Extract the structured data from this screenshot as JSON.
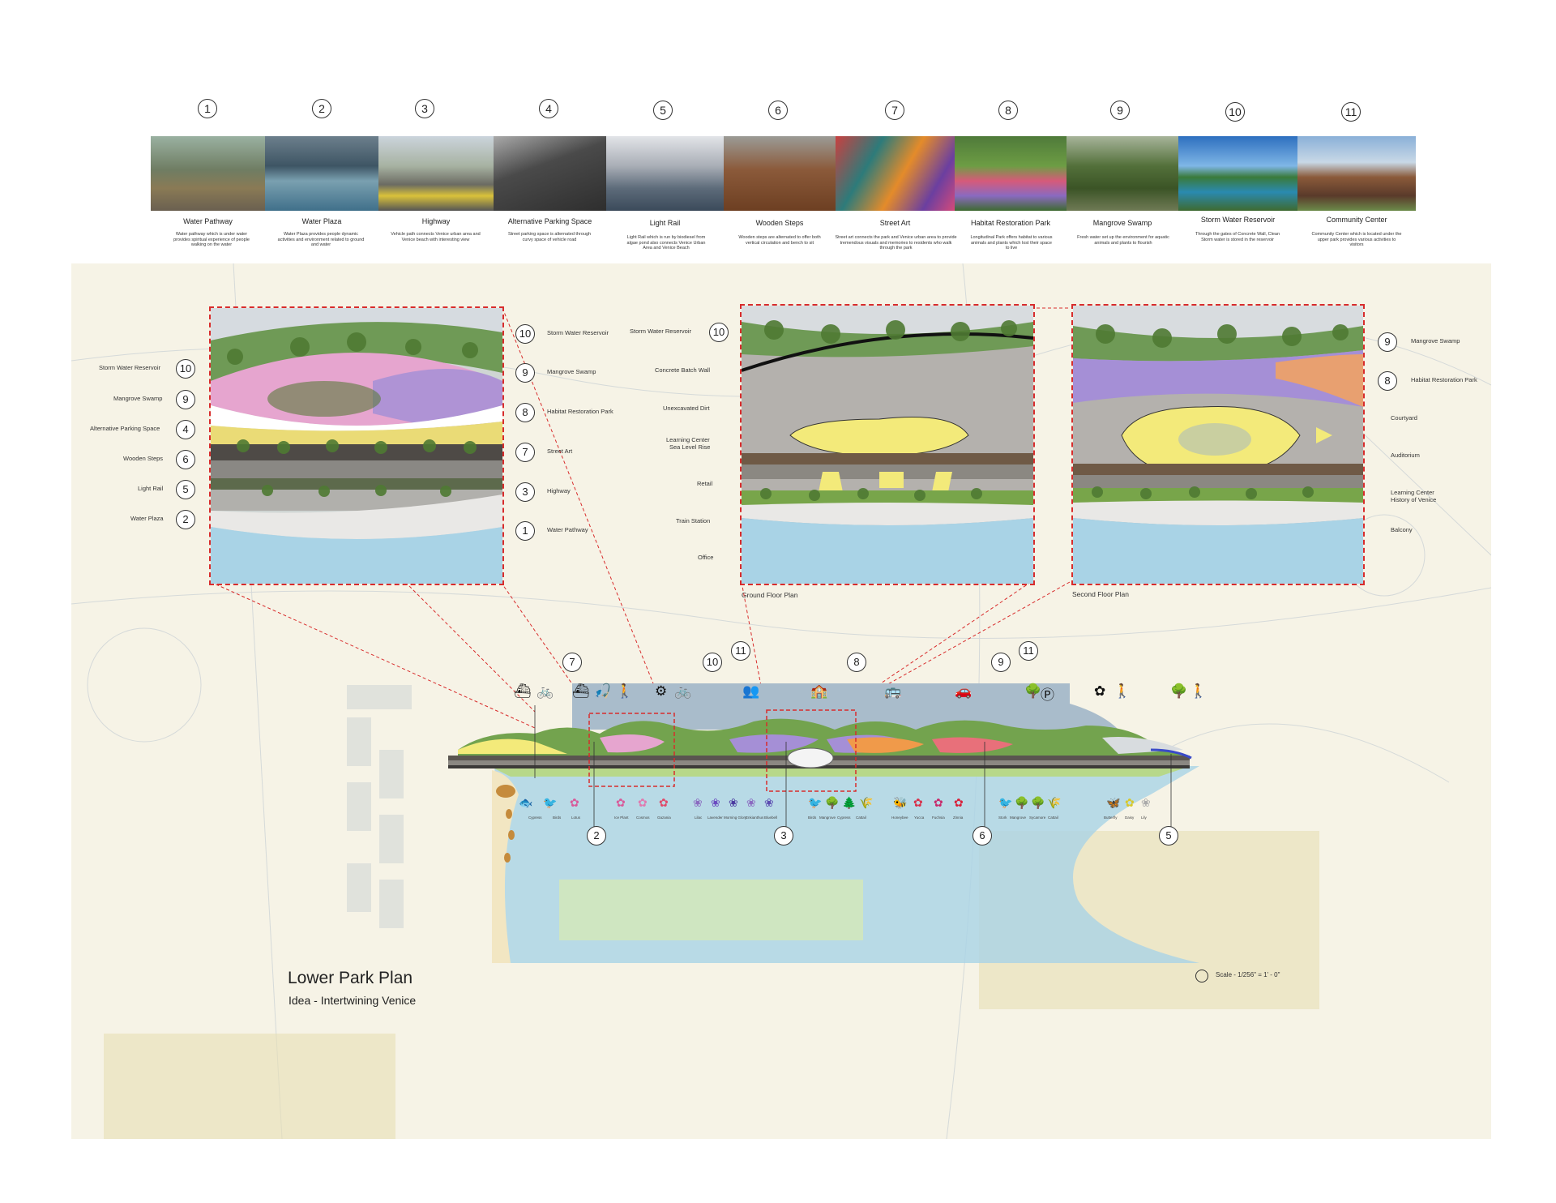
{
  "header": {
    "items": [
      {
        "num": "1",
        "title": "Water Pathway",
        "desc": "Water pathway which is under water provides spiritual experience of people walking on the water"
      },
      {
        "num": "2",
        "title": "Water Plaza",
        "desc": "Water Plaza provides people dynamic activities and environment related to ground and water"
      },
      {
        "num": "3",
        "title": "Highway",
        "desc": "Vehicle path connects Venice urban area and Venice beach with interesting view"
      },
      {
        "num": "4",
        "title": "Alternative Parking Space",
        "desc": "Street parking space is alternated through curvy space of vehicle road"
      },
      {
        "num": "5",
        "title": "Light Rail",
        "desc": "Light Rail which is run by biodiesel from algae pond also connects Venice Urban Area and Venice Beach"
      },
      {
        "num": "6",
        "title": "Wooden Steps",
        "desc": "Wooden steps are alternated to offer both vertical circulation and bench to sit"
      },
      {
        "num": "7",
        "title": "Street Art",
        "desc": "Street art connects the park and Venice urban area to provide tremendous visuals and memories to residents who walk through the park"
      },
      {
        "num": "8",
        "title": "Habitat Restoration Park",
        "desc": "Longitudinal Park offers habitat to various animals and plants which lost their space to live"
      },
      {
        "num": "9",
        "title": "Mangrove Swamp",
        "desc": "Fresh water set up the environment for aquatic animals and plants to flourish"
      },
      {
        "num": "10",
        "title": "Storm Water Reservoir",
        "desc": "Through the gates of Concrete Wall, Clean Storm water is stored in the reservoir"
      },
      {
        "num": "11",
        "title": "Community Center",
        "desc": "Community Center which is located under the upper park provides various activities to visitors"
      }
    ]
  },
  "panel1": {
    "left_labels": [
      {
        "num": "10",
        "text": "Storm Water Reservoir"
      },
      {
        "num": "9",
        "text": "Mangrove Swamp"
      },
      {
        "num": "4",
        "text": "Alternative Parking Space"
      },
      {
        "num": "6",
        "text": "Wooden Steps"
      },
      {
        "num": "5",
        "text": "Light Rail"
      },
      {
        "num": "2",
        "text": "Water Plaza"
      }
    ],
    "right_labels": [
      {
        "num": "10",
        "text": "Storm Water Reservoir"
      },
      {
        "num": "9",
        "text": "Mangrove Swamp"
      },
      {
        "num": "8",
        "text": "Habitat Restoration Park"
      },
      {
        "num": "7",
        "text": "Street Art"
      },
      {
        "num": "3",
        "text": "Highway"
      },
      {
        "num": "1",
        "text": "Water Pathway"
      }
    ]
  },
  "panel2": {
    "top_label": {
      "num": "10",
      "text": "Storm Water Reservoir"
    },
    "labels": [
      "Concrete Batch Wall",
      "Unexcavated Dirt",
      "Learning Center",
      "Sea Level Rise",
      "Retail",
      "Train Station",
      "Office"
    ],
    "caption": "Ground Floor Plan"
  },
  "panel3": {
    "labels_numbered": [
      {
        "num": "9",
        "text": "Mangrove Swamp"
      },
      {
        "num": "8",
        "text": "Habitat Restoration Park"
      }
    ],
    "labels": [
      "Courtyard",
      "Auditorium",
      "Learning Center",
      "History of Venice",
      "Balcony"
    ],
    "caption": "Second Floor Plan"
  },
  "plan": {
    "top_nums": [
      "7",
      "10",
      "11",
      "8",
      "9",
      "11"
    ],
    "bottom_nums": [
      "2",
      "3",
      "6",
      "5"
    ],
    "plants": [
      "Cypress",
      "Birds",
      "Lotus",
      "Ice Plant",
      "Cosmos",
      "Gazania",
      "Lilac",
      "Lavender",
      "Morning Glory",
      "Enkianthus",
      "Bluebell",
      "Birds",
      "Mangrove",
      "Cypress",
      "Cattail",
      "Honeybee",
      "Yucca",
      "Fuchsia",
      "Zinnia",
      "Stork",
      "Mangrove",
      "Sycamore",
      "Cattail",
      "Butterfly",
      "Daisy",
      "Lily"
    ],
    "title": "Lower Park Plan",
    "subtitle": "Idea - Intertwining Venice",
    "scale": "Scale - 1/256\" = 1' - 0\""
  },
  "colors": {
    "dash_red": "#d82c2c",
    "water": "#a9d3e6",
    "green": "#5f8f3e",
    "yellow": "#f3ea7a",
    "purple": "#a58fd6",
    "pink": "#e6a5cf"
  }
}
